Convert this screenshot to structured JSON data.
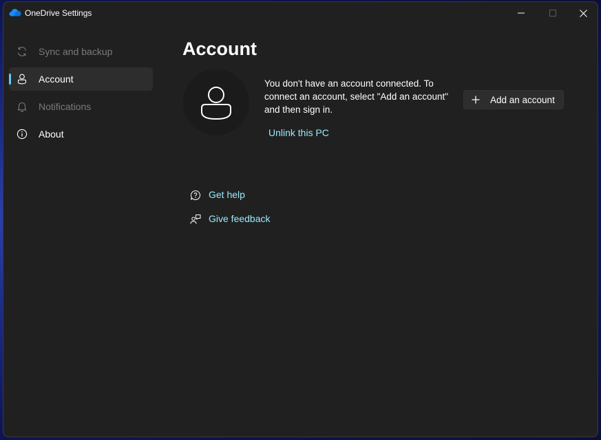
{
  "window": {
    "title": "OneDrive Settings"
  },
  "sidebar": {
    "items": [
      {
        "label": "Sync and backup",
        "icon": "sync-icon",
        "state": "disabled"
      },
      {
        "label": "Account",
        "icon": "person-icon",
        "state": "selected"
      },
      {
        "label": "Notifications",
        "icon": "bell-icon",
        "state": "disabled"
      },
      {
        "label": "About",
        "icon": "info-icon",
        "state": "normal"
      }
    ]
  },
  "main": {
    "title": "Account",
    "description": "You don't have an account connected. To connect an account, select \"Add an account\" and then sign in.",
    "unlink_label": "Unlink this PC",
    "add_account_label": "Add an account",
    "links": [
      {
        "label": "Get help",
        "icon": "help-icon"
      },
      {
        "label": "Give feedback",
        "icon": "feedback-icon"
      }
    ]
  },
  "colors": {
    "accent": "#60cdff",
    "link": "#99ebff",
    "background": "#202020"
  }
}
